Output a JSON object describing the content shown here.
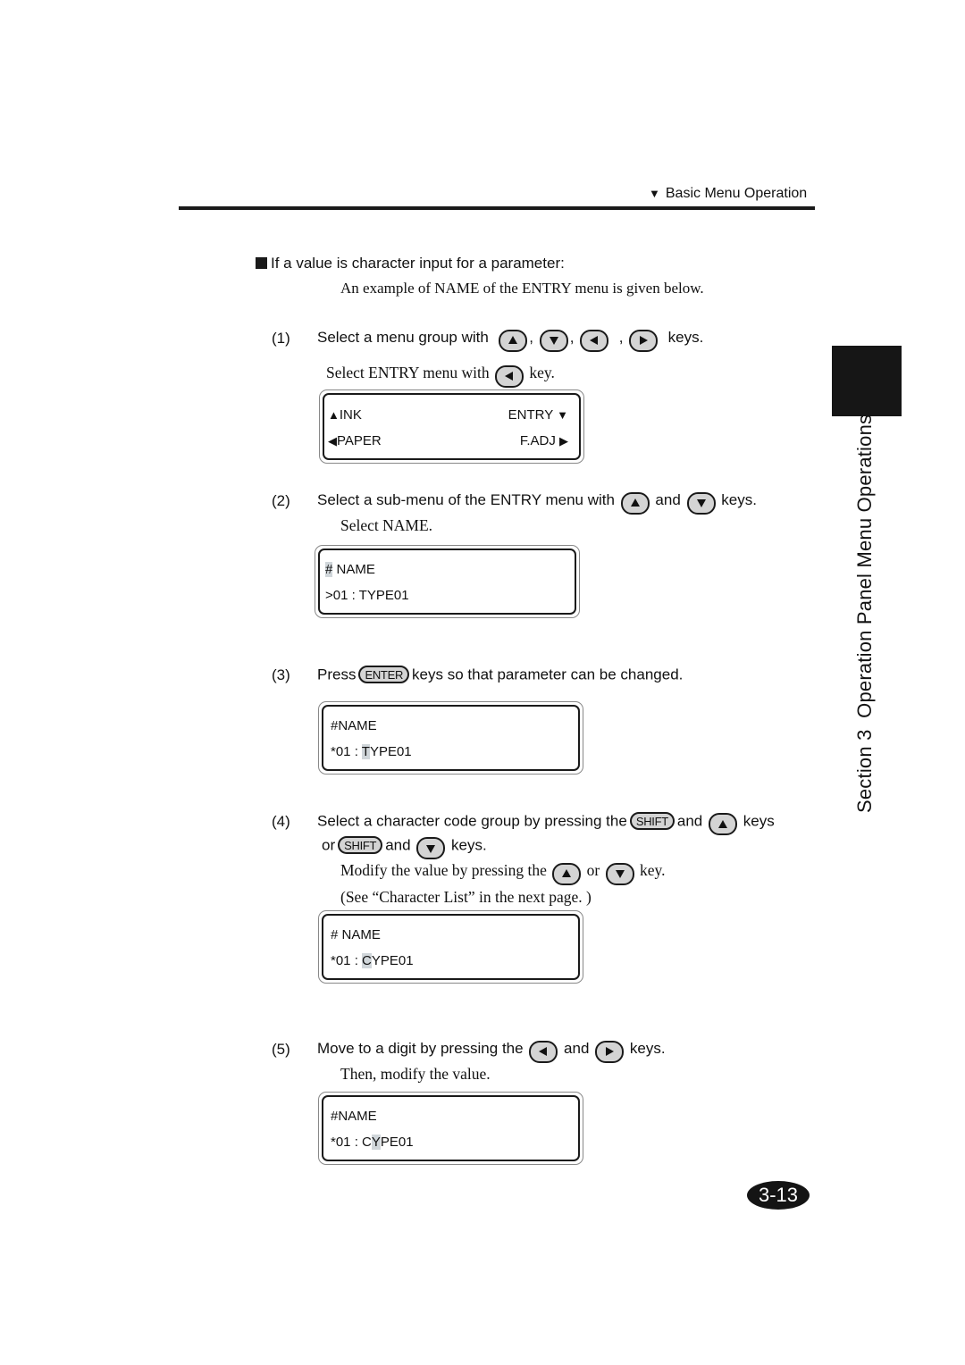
{
  "header": {
    "marker_icon": "triangle-down-icon",
    "title": "Basic Menu Operation"
  },
  "section": {
    "heading": "If a value is character input for a parameter:",
    "intro": "An example of NAME of the ENTRY menu is given below."
  },
  "steps": [
    {
      "num": "(1)",
      "text_before": "Select a menu group with",
      "keys": [
        "up-key",
        "down-key",
        "left-key",
        "right-key"
      ],
      "separators": [
        ",",
        ",",
        ","
      ],
      "text_after": "keys.",
      "sub_before": "Select ENTRY menu with",
      "sub_key": "left-key",
      "sub_after": "key.",
      "lcd": {
        "rows": [
          {
            "left_icon": "▲",
            "left": "INK",
            "right": "ENTRY",
            "right_icon": "▼"
          },
          {
            "left_icon": "◀",
            "left": "PAPER",
            "right": "F.ADJ",
            "right_icon": "▶"
          }
        ]
      }
    },
    {
      "num": "(2)",
      "text_before": "Select a sub-menu of the ENTRY menu with",
      "key1": "up-key",
      "and": "and",
      "key2": "down-key",
      "text_after": "keys.",
      "sub": "Select NAME.",
      "lcd": {
        "line1_hl": "#",
        "line1_rest": " NAME",
        "line2": ">01 : TYPE01"
      }
    },
    {
      "num": "(3)",
      "text_before": "Press",
      "key_label": "ENTER",
      "text_after": "keys so that parameter can be changed.",
      "lcd": {
        "line1": "#NAME",
        "line2_pre": "*01 : ",
        "line2_hl": "T",
        "line2_post": "YPE01"
      }
    },
    {
      "num": "(4)",
      "text_before": "Select a character code group by pressing the",
      "shift_label": "SHIFT",
      "and": "and",
      "text_keys": "keys",
      "or": "or",
      "text_keys2": "keys.",
      "sub1_before": "Modify the value by pressing the",
      "sub1_or": "or",
      "sub1_after": "key.",
      "sub2": "(See “Character List” in the next page. )",
      "lcd": {
        "line1": "# NAME",
        "line2_pre": "*01 : ",
        "line2_hl": "C",
        "line2_post": "YPE01"
      }
    },
    {
      "num": "(5)",
      "text_before": "Move to a digit by pressing the",
      "and": "and",
      "text_after": "keys.",
      "sub": "Then, modify the value.",
      "lcd": {
        "line1": "#NAME",
        "line2_pre": "*01 : C",
        "line2_hl": "Y",
        "line2_post": "PE01"
      }
    }
  ],
  "sidebar": {
    "tab_label": "Section 3  Operation Panel Menu Operations"
  },
  "page_number": "3-13"
}
